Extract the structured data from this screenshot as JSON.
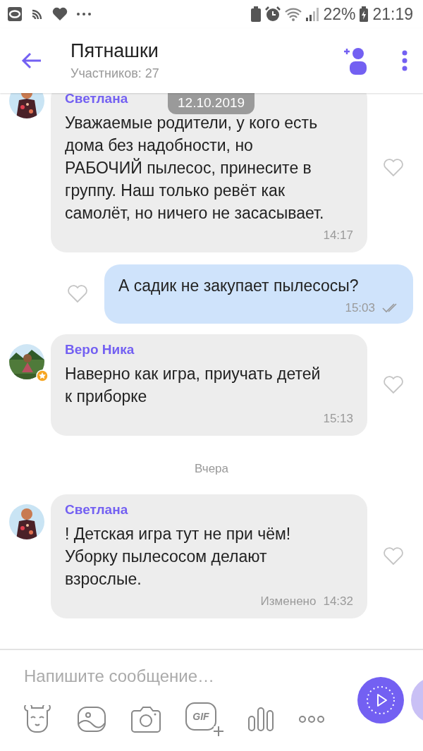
{
  "status_bar": {
    "battery": "22%",
    "time": "21:19"
  },
  "header": {
    "title": "Пятнашки",
    "subtitle": "Участников: 27"
  },
  "date_badge": "12.10.2019",
  "messages": [
    {
      "kind": "incoming",
      "sender": "Светлана",
      "text": "Уважаемые родители, у кого есть дома без надобности, но РАБОЧИЙ пылесос, принесите в группу. Наш только ревёт как самолёт, но ничего не засасывает.",
      "time": "14:17",
      "liked": false,
      "avatar_badge": false
    },
    {
      "kind": "outgoing",
      "text": "А садик не закупает пылесосы?",
      "time": "15:03",
      "liked": false,
      "read": true
    },
    {
      "kind": "incoming",
      "sender": "Веро Ника",
      "text": "Наверно как игра, приучать детей к приборке",
      "time": "15:13",
      "liked": false,
      "avatar_badge": true
    },
    {
      "kind": "separator",
      "text": "Вчера"
    },
    {
      "kind": "incoming",
      "sender": "Светлана",
      "text": "! Детская игра тут не при чём! Уборку пылесосом делают взрослые.",
      "edited": "Изменено",
      "time": "14:32",
      "liked": false,
      "avatar_badge": false
    }
  ],
  "composer": {
    "placeholder": "Напишите сообщение…",
    "gif_label": "GIF"
  }
}
